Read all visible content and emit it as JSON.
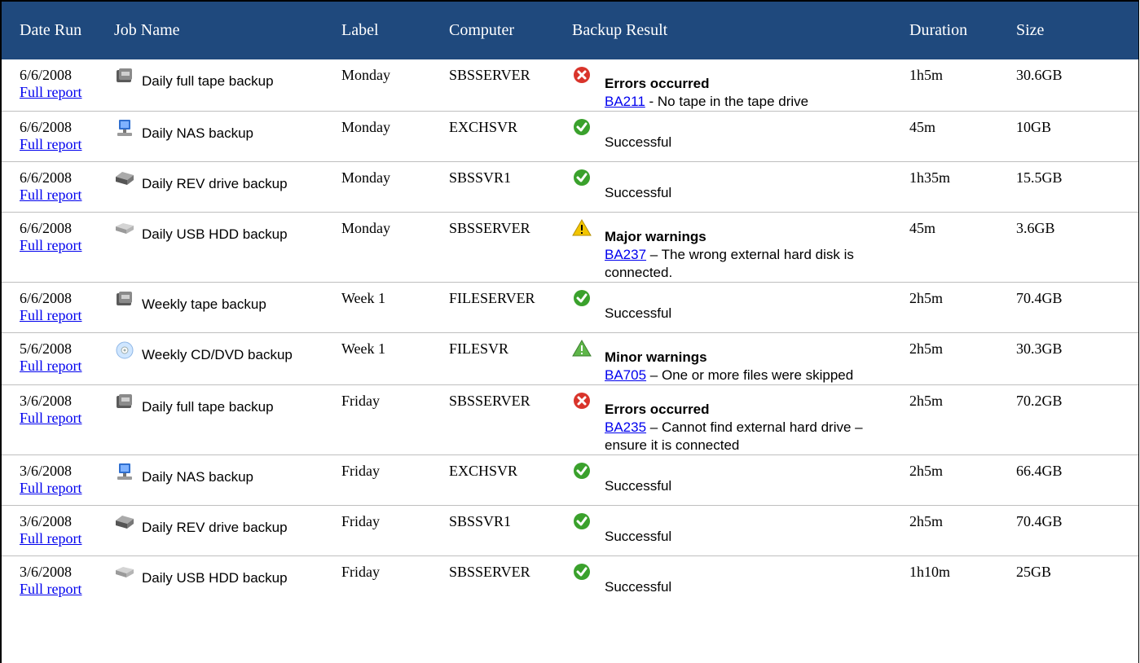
{
  "columns": {
    "date": "Date Run",
    "job": "Job Name",
    "label": "Label",
    "computer": "Computer",
    "result": "Backup Result",
    "duration": "Duration",
    "size": "Size"
  },
  "report_link": "Full report",
  "rows": [
    {
      "date": "6/6/2008",
      "job": "Daily full tape backup",
      "job_icon": "tape-drive-icon",
      "label": "Monday",
      "computer": "SBSSERVER",
      "status": "error",
      "result_title": "Errors occurred",
      "code": "BA211",
      "message": " - No tape in the tape drive",
      "duration": "1h5m",
      "size": "30.6GB"
    },
    {
      "date": "6/6/2008",
      "job": "Daily NAS backup",
      "job_icon": "nas-computer-icon",
      "label": "Monday",
      "computer": "EXCHSVR",
      "status": "success",
      "result_title": "Successful",
      "code": "",
      "message": "",
      "duration": "45m",
      "size": "10GB"
    },
    {
      "date": "6/6/2008",
      "job": "Daily REV drive backup",
      "job_icon": "rev-drive-icon",
      "label": "Monday",
      "computer": "SBSSVR1",
      "status": "success",
      "result_title": "Successful",
      "code": "",
      "message": "",
      "duration": "1h35m",
      "size": "15.5GB"
    },
    {
      "date": "6/6/2008",
      "job": "Daily USB HDD backup",
      "job_icon": "usb-hdd-icon",
      "label": "Monday",
      "computer": "SBSSERVER",
      "status": "major",
      "result_title": "Major warnings",
      "code": "BA237",
      "message": " – The wrong external hard disk is connected.",
      "duration": "45m",
      "size": "3.6GB"
    },
    {
      "date": "6/6/2008",
      "job": "Weekly tape backup",
      "job_icon": "tape-drive-icon",
      "label": "Week 1",
      "computer": "FILESERVER",
      "status": "success",
      "result_title": "Successful",
      "code": "",
      "message": "",
      "duration": "2h5m",
      "size": "70.4GB"
    },
    {
      "date": "5/6/2008",
      "job": "Weekly CD/DVD backup",
      "job_icon": "cd-dvd-icon",
      "label": "Week 1",
      "computer": "FILESVR",
      "status": "minor",
      "result_title": "Minor warnings",
      "code": "BA705",
      "message": " – One or more files were skipped",
      "duration": "2h5m",
      "size": "30.3GB"
    },
    {
      "date": "3/6/2008",
      "job": "Daily full tape backup",
      "job_icon": "tape-drive-icon",
      "label": "Friday",
      "computer": "SBSSERVER",
      "status": "error",
      "result_title": "Errors occurred",
      "code": "BA235",
      "message": " – Cannot find external hard drive – ensure it is connected",
      "duration": "2h5m",
      "size": "70.2GB"
    },
    {
      "date": "3/6/2008",
      "job": "Daily NAS backup",
      "job_icon": "nas-computer-icon",
      "label": "Friday",
      "computer": "EXCHSVR",
      "status": "success",
      "result_title": "Successful",
      "code": "",
      "message": "",
      "duration": "2h5m",
      "size": "66.4GB"
    },
    {
      "date": "3/6/2008",
      "job": "Daily REV drive backup",
      "job_icon": "rev-drive-icon",
      "label": "Friday",
      "computer": "SBSSVR1",
      "status": "success",
      "result_title": "Successful",
      "code": "",
      "message": "",
      "duration": "2h5m",
      "size": "70.4GB"
    },
    {
      "date": "3/6/2008",
      "job": "Daily USB HDD backup",
      "job_icon": "usb-hdd-icon",
      "label": "Friday",
      "computer": "SBSSERVER",
      "status": "success",
      "result_title": "Successful",
      "code": "",
      "message": "",
      "duration": "1h10m",
      "size": "25GB"
    }
  ],
  "colors": {
    "header_bg": "#1f497d",
    "header_text": "#ffffff",
    "link": "#0000ee",
    "error": "#d9342b",
    "success": "#3aa12c",
    "warning": "#f2c500"
  }
}
